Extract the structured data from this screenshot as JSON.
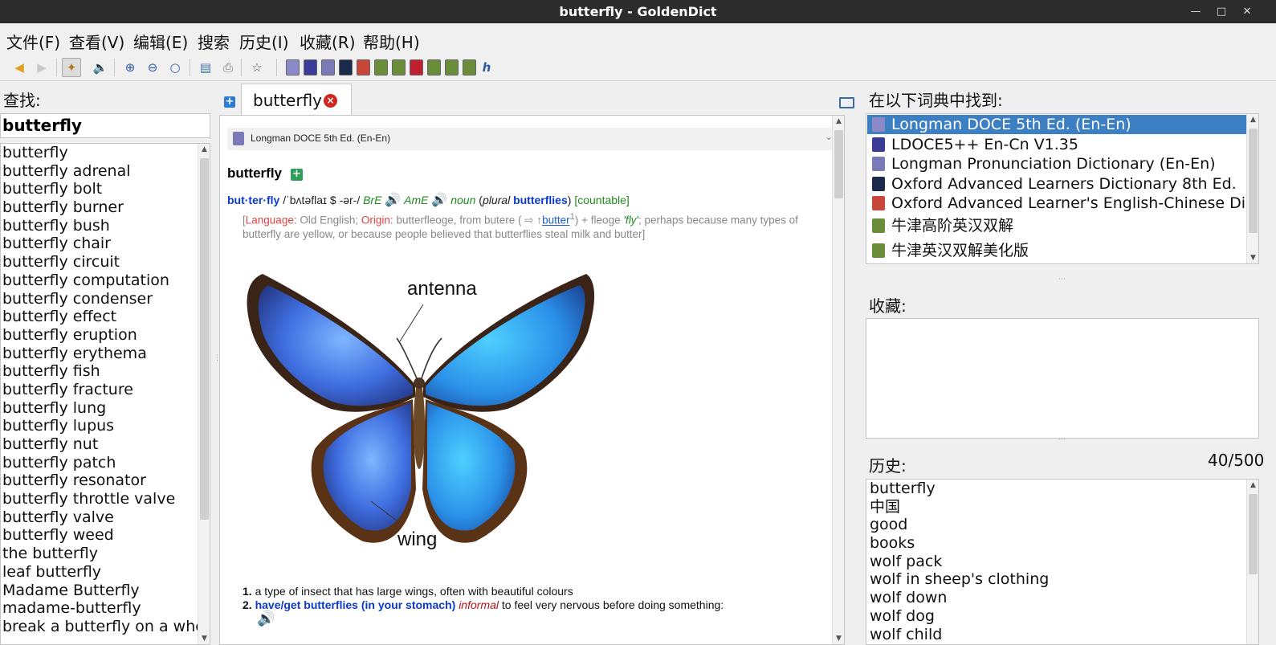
{
  "window": {
    "title": "butterfly - GoldenDict"
  },
  "menu": [
    "文件(F)",
    "查看(V)",
    "编辑(E)",
    "搜索",
    "历史(I)",
    "收藏(R)",
    "帮助(H)"
  ],
  "left": {
    "find_label": "查找:",
    "search_value": "butterfly",
    "words": [
      "butterfly",
      "butterfly adrenal",
      "butterfly bolt",
      "butterfly burner",
      "butterfly bush",
      "butterfly chair",
      "butterfly circuit",
      "butterfly computation",
      "butterfly condenser",
      "butterfly effect",
      "butterfly eruption",
      "butterfly erythema",
      "butterfly fish",
      "butterfly fracture",
      "butterfly lung",
      "butterfly lupus",
      "butterfly nut",
      "butterfly patch",
      "butterfly resonator",
      "butterfly throttle valve",
      "butterfly valve",
      "butterfly weed",
      "the butterfly",
      "leaf butterfly",
      "Madame Butterfly",
      "madame-butterfly",
      "break a butterfly on a wheel"
    ]
  },
  "tab": {
    "label": "butterfly"
  },
  "article": {
    "dict_name": "Longman DOCE 5th Ed. (En-En)",
    "headword": "butterfly",
    "syllables": "but·ter·fly",
    "ipa": "/ˈbʌtəflaɪ $ -ər-/",
    "bre": "BrE",
    "ame": "AmE",
    "pos": "noun",
    "plural_label": "plural",
    "plural_form": "butterflies",
    "countable": "[countable]",
    "etym_language_label": "Language:",
    "etym_language": "Old English",
    "etym_origin_label": "Origin:",
    "etym_text1": "butterfleoge, from butere (",
    "etym_link": "butter",
    "etym_text2": ") + fleoge",
    "etym_fly": "'fly'",
    "etym_text3": "; perhaps because many types of butterfly are yellow, or because people believed that butterflies steal milk and butter",
    "picture_labels": {
      "antenna": "antenna",
      "wing": "wing"
    },
    "defs": [
      {
        "num": "1.",
        "text": "a type of insect that has large wings, often with beautiful colours"
      },
      {
        "num": "2.",
        "phrase": "have/get butterflies (in your stomach)",
        "register": "informal",
        "text": "to feel very nervous before doing something:"
      }
    ]
  },
  "right": {
    "found_label": "在以下词典中找到:",
    "dicts": [
      {
        "name": "Longman DOCE 5th Ed. (En-En)",
        "icon": "longman-icon",
        "color": "#8a8ac8"
      },
      {
        "name": "LDOCE5++ En-Cn V1.35",
        "icon": "ldoce-icon",
        "color": "#3b3b9a"
      },
      {
        "name": "Longman Pronunciation Dictionary (En-En)",
        "icon": "lpd-icon",
        "color": "#7a7ab8"
      },
      {
        "name": "Oxford Advanced Learners Dictionary 8th Ed.",
        "icon": "oald-icon",
        "color": "#1b2a4a"
      },
      {
        "name": "Oxford Advanced Learner's English-Chinese Dictionary",
        "icon": "oalecd-icon",
        "color": "#c8463a"
      },
      {
        "name": "牛津高阶英汉双解",
        "icon": "book-icon",
        "color": "#6a8d3a"
      },
      {
        "name": "牛津英汉双解美化版",
        "icon": "book-icon",
        "color": "#6a8d3a"
      }
    ],
    "favorites_label": "收藏:",
    "history_label": "历史:",
    "history_count": "40/500",
    "history": [
      "butterfly",
      "中国",
      "good",
      "books",
      "wolf pack",
      "wolf in sheep's clothing",
      "wolf down",
      "wolf dog",
      "wolf child"
    ]
  }
}
